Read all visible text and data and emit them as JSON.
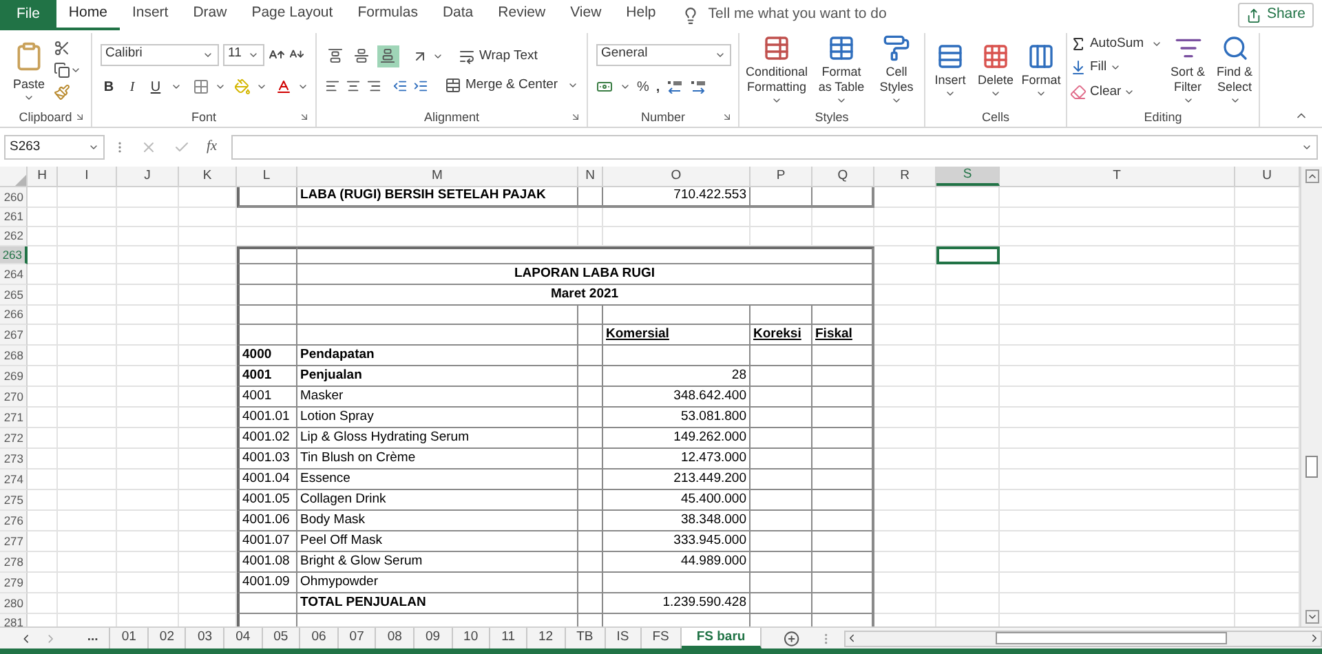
{
  "menu_tabs": [
    {
      "label": "File",
      "kind": "backstage",
      "selected": false
    },
    {
      "label": "Home",
      "kind": "tab",
      "selected": true
    },
    {
      "label": "Insert",
      "kind": "tab",
      "selected": false
    },
    {
      "label": "Draw",
      "kind": "tab",
      "selected": false
    },
    {
      "label": "Page Layout",
      "kind": "tab",
      "selected": false
    },
    {
      "label": "Formulas",
      "kind": "tab",
      "selected": false
    },
    {
      "label": "Data",
      "kind": "tab",
      "selected": false
    },
    {
      "label": "Review",
      "kind": "tab",
      "selected": false
    },
    {
      "label": "View",
      "kind": "tab",
      "selected": false
    },
    {
      "label": "Help",
      "kind": "tab",
      "selected": false
    }
  ],
  "tell_me": {
    "placeholder": "Tell me what you want to do"
  },
  "share_button": {
    "label": "Share"
  },
  "ribbon": {
    "clipboard": {
      "paste": "Paste",
      "group_label": "Clipboard"
    },
    "font": {
      "font_name": "Calibri",
      "font_size": "11",
      "styles": [
        "B",
        "I",
        "U"
      ],
      "group_label": "Font"
    },
    "alignment": {
      "vertical": [
        {
          "kind": "top",
          "selected": false
        },
        {
          "kind": "middle",
          "selected": false
        },
        {
          "kind": "bottom",
          "selected": true
        }
      ],
      "wrap_text": "Wrap Text",
      "merge": "Merge & Center",
      "group_label": "Alignment"
    },
    "number": {
      "format": "General",
      "percent": "%",
      "comma": ",",
      "group_label": "Number"
    },
    "styles": {
      "buttons": [
        {
          "kind": "conditional",
          "label": "Conditional Formatting"
        },
        {
          "kind": "table",
          "label": "Format as Table"
        },
        {
          "kind": "cell",
          "label": "Cell Styles"
        }
      ],
      "group_label": "Styles"
    },
    "cells": {
      "buttons": [
        {
          "kind": "insert",
          "label": "Insert"
        },
        {
          "kind": "delete",
          "label": "Delete"
        },
        {
          "kind": "format",
          "label": "Format"
        }
      ],
      "group_label": "Cells"
    },
    "editing": {
      "autosum": "AutoSum",
      "fill": "Fill",
      "clear": "Clear",
      "sort": "Sort & Filter",
      "find": "Find & Select",
      "group_label": "Editing"
    }
  },
  "formula_bar": {
    "name_box": "S263",
    "function_label": "fx"
  },
  "columns": [
    {
      "label": "H",
      "selected": false
    },
    {
      "label": "I",
      "selected": false
    },
    {
      "label": "J",
      "selected": false
    },
    {
      "label": "K",
      "selected": false
    },
    {
      "label": "L",
      "selected": false
    },
    {
      "label": "M",
      "selected": false
    },
    {
      "label": "N",
      "selected": false
    },
    {
      "label": "O",
      "selected": false
    },
    {
      "label": "P",
      "selected": false
    },
    {
      "label": "Q",
      "selected": false
    },
    {
      "label": "R",
      "selected": false
    },
    {
      "label": "S",
      "selected": true
    },
    {
      "label": "T",
      "selected": false
    },
    {
      "label": "U",
      "selected": false
    }
  ],
  "rows": [
    {
      "number": "260",
      "selected": false,
      "kind": "summary",
      "label": "LABA (RUGI) BERSIH SETELAH PAJAK",
      "amount": "710.422.553"
    },
    {
      "number": "261",
      "selected": false,
      "kind": "empty"
    },
    {
      "number": "262",
      "selected": false,
      "kind": "empty"
    },
    {
      "number": "263",
      "selected": true,
      "kind": "frame_top"
    },
    {
      "number": "264",
      "selected": false,
      "kind": "title",
      "label": "LAPORAN LABA RUGI"
    },
    {
      "number": "265",
      "selected": false,
      "kind": "title",
      "label": "Maret 2021"
    },
    {
      "number": "266",
      "selected": false,
      "kind": "blank"
    },
    {
      "number": "267",
      "selected": false,
      "kind": "heading",
      "amount": "Komersial",
      "koreksi": "Koreksi",
      "fiskal": "Fiskal"
    },
    {
      "number": "268",
      "selected": false,
      "kind": "group",
      "code": "4000",
      "label": "Pendapatan"
    },
    {
      "number": "269",
      "selected": false,
      "kind": "group",
      "code": "4001",
      "label": "Penjualan",
      "amount": "28"
    },
    {
      "number": "270",
      "selected": false,
      "kind": "item",
      "code": "4001",
      "label": "Masker",
      "amount": "348.642.400"
    },
    {
      "number": "271",
      "selected": false,
      "kind": "item",
      "code": "4001.01",
      "label": "Lotion Spray",
      "amount": "53.081.800"
    },
    {
      "number": "272",
      "selected": false,
      "kind": "item",
      "code": "4001.02",
      "label": "Lip & Gloss Hydrating Serum",
      "amount": "149.262.000"
    },
    {
      "number": "273",
      "selected": false,
      "kind": "item",
      "code": "4001.03",
      "label": "Tin Blush on Crème",
      "amount": "12.473.000"
    },
    {
      "number": "274",
      "selected": false,
      "kind": "item",
      "code": "4001.04",
      "label": "Essence",
      "amount": "213.449.200"
    },
    {
      "number": "275",
      "selected": false,
      "kind": "item",
      "code": "4001.05",
      "label": "Collagen Drink",
      "amount": "45.400.000"
    },
    {
      "number": "276",
      "selected": false,
      "kind": "item",
      "code": "4001.06",
      "label": "Body Mask",
      "amount": "38.348.000"
    },
    {
      "number": "277",
      "selected": false,
      "kind": "item",
      "code": "4001.07",
      "label": "Peel Off Mask",
      "amount": "333.945.000"
    },
    {
      "number": "278",
      "selected": false,
      "kind": "item",
      "code": "4001.08",
      "label": "Bright & Glow Serum",
      "amount": "44.989.000"
    },
    {
      "number": "279",
      "selected": false,
      "kind": "item",
      "code": "4001.09",
      "label": "Ohmypowder"
    },
    {
      "number": "280",
      "selected": false,
      "kind": "total",
      "label": "TOTAL PENJUALAN",
      "amount": "1.239.590.428"
    },
    {
      "number": "281",
      "selected": false,
      "kind": "blank"
    }
  ],
  "sheet_nav": {
    "more": "..."
  },
  "sheet_tabs": [
    {
      "label": "01",
      "selected": false
    },
    {
      "label": "02",
      "selected": false
    },
    {
      "label": "03",
      "selected": false
    },
    {
      "label": "04",
      "selected": false
    },
    {
      "label": "05",
      "selected": false
    },
    {
      "label": "06",
      "selected": false
    },
    {
      "label": "07",
      "selected": false
    },
    {
      "label": "08",
      "selected": false
    },
    {
      "label": "09",
      "selected": false
    },
    {
      "label": "10",
      "selected": false
    },
    {
      "label": "11",
      "selected": false
    },
    {
      "label": "12",
      "selected": false
    },
    {
      "label": "TB",
      "selected": false
    },
    {
      "label": "IS",
      "selected": false
    },
    {
      "label": "FS",
      "selected": false
    },
    {
      "label": "FS baru",
      "selected": true
    }
  ]
}
